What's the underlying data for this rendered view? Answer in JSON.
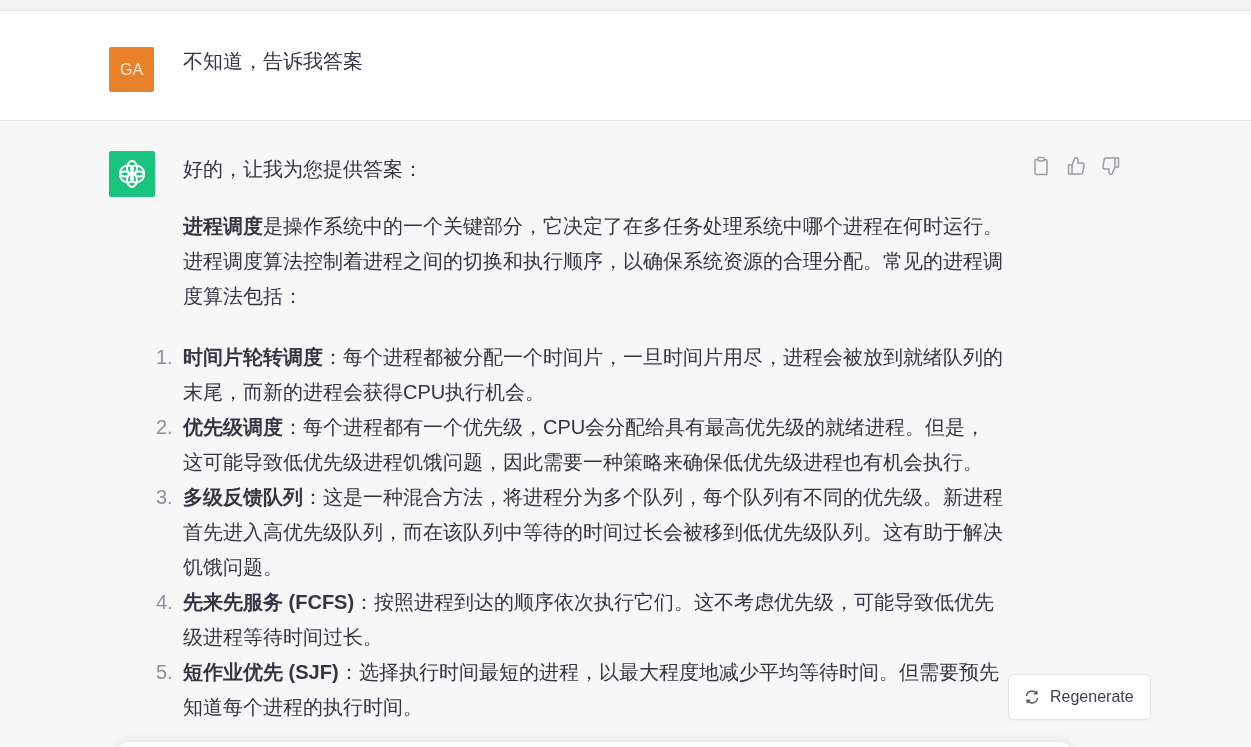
{
  "user_message": {
    "avatar": "GA",
    "text": "不知道，告诉我答案"
  },
  "assistant_message": {
    "greeting": "好的，让我为您提供答案：",
    "intro": "**进程调度**是操作系统中的一个关键部分，它决定了在多任务处理系统中哪个进程在何时运行。进程调度算法控制着进程之间的切换和执行顺序，以确保系统资源的合理分配。常见的进程调度算法包括：",
    "items": [
      {
        "number": "1.",
        "term": "时间片轮转调度",
        "text": "：每个进程都被分配一个时间片，一旦时间片用尽，进程会被放到就绪队列的末尾，而新的进程会获得CPU执行机会。"
      },
      {
        "number": "2.",
        "term": "优先级调度",
        "text": "：每个进程都有一个优先级，CPU会分配给具有最高优先级的就绪进程。但是，这可能导致低优先级进程饥饿问题，因此需要一种策略来确保低优先级进程也有机会执行。"
      },
      {
        "number": "3.",
        "term": "多级反馈队列",
        "text": "：这是一种混合方法，将进程分为多个队列，每个队列有不同的优先级。新进程首先进入高优先级队列，而在该队列中等待的时间过长会被移到低优先级队列。这有助于解决饥饿问题。"
      },
      {
        "number": "4.",
        "term": "先来先服务 (FCFS)",
        "text": "：按照进程到达的顺序依次执行它们。这不考虑优先级，可能导致低优先级进程等待时间过长。"
      },
      {
        "number": "5.",
        "term": "短作业优先 (SJF)",
        "text": "：选择执行时间最短的进程，以最大程度地减少平均等待时间。但需要预先知道每个进程的执行时间。"
      }
    ]
  },
  "regenerate_button": {
    "label": "Regenerate"
  }
}
